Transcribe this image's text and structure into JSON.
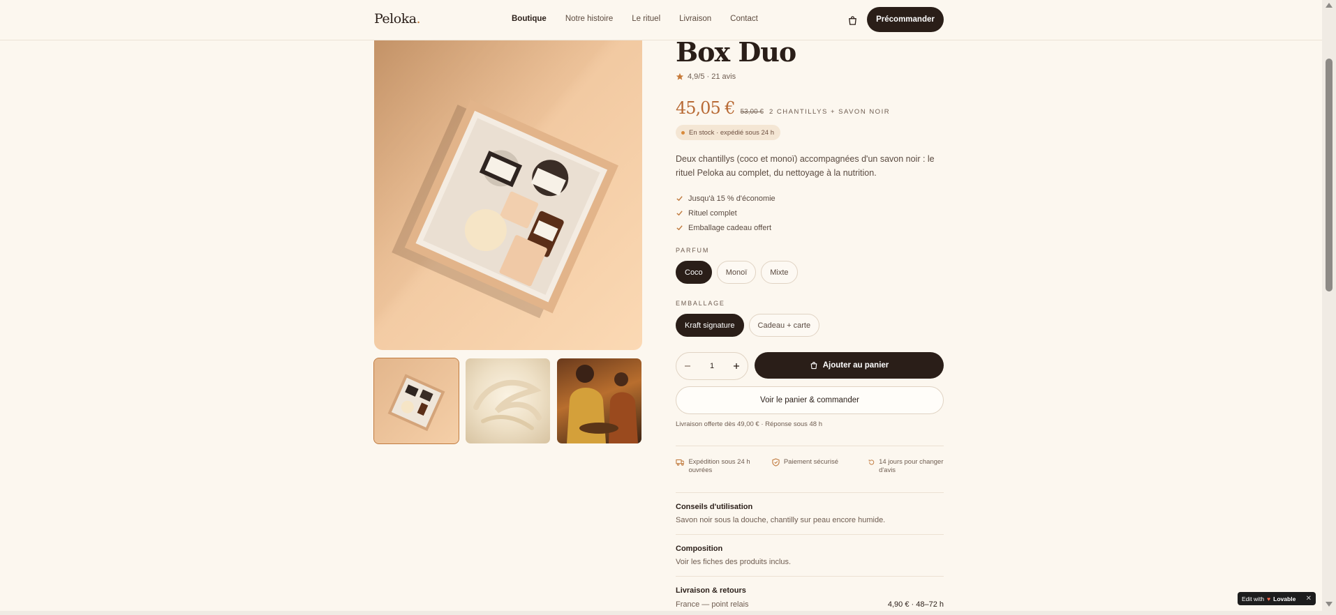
{
  "header": {
    "logo": "Peloka",
    "logo_dot": ".",
    "nav": [
      "Boutique",
      "Notre histoire",
      "Le rituel",
      "Livraison",
      "Contact"
    ],
    "active_nav": "Boutique",
    "cta": "Précommander"
  },
  "product": {
    "title": "Box Duo",
    "rating": "4,9/5 · 21 avis",
    "price": "45,05 €",
    "old_price": "53,00 €",
    "price_tag": "2 CHANTILLYS + SAVON NOIR",
    "stock": "En stock · expédié sous 24 h",
    "description": "Deux chantillys (coco et monoï) accompagnées d'un savon noir : le rituel Peloka au complet, du nettoyage à la nutrition.",
    "features": [
      "Jusqu'à 15 % d'économie",
      "Rituel complet",
      "Emballage cadeau offert"
    ],
    "parfum_label": "PARFUM",
    "parfums": [
      "Coco",
      "Monoï",
      "Mixte"
    ],
    "parfum_selected": "Coco",
    "emballage_label": "EMBALLAGE",
    "emballages": [
      "Kraft signature",
      "Cadeau + carte"
    ],
    "emballage_selected": "Kraft signature",
    "quantity": "1",
    "add_to_cart": "Ajouter au panier",
    "view_cart": "Voir le panier & commander",
    "shipping_note": "Livraison offerte dès 49,00 € · Réponse sous 48 h",
    "perks": [
      {
        "icon": "truck-icon",
        "text": "Expédition sous 24 h ouvrées"
      },
      {
        "icon": "shield-icon",
        "text": "Paiement sécurisé"
      },
      {
        "icon": "refresh-icon",
        "text": "14 jours pour changer d'avis"
      }
    ],
    "accordion": [
      {
        "title": "Conseils d'utilisation",
        "body": "Savon noir sous la douche, chantilly sur peau encore humide."
      },
      {
        "title": "Composition",
        "body": "Voir les fiches des produits inclus."
      },
      {
        "title": "Livraison & retours",
        "body": "France — point relais",
        "right": "4,90 € · 48–72 h"
      }
    ]
  },
  "badge": {
    "prefix": "Edit with",
    "brand": "Lovable"
  },
  "colors": {
    "accent": "#b86a35",
    "dark": "#2a1e18",
    "background": "#fcf7ef"
  }
}
